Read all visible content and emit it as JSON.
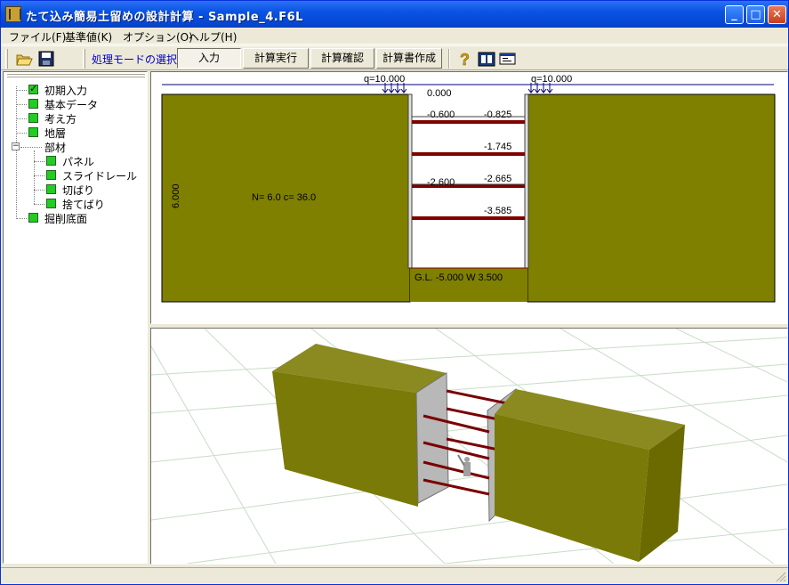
{
  "window": {
    "title": "たて込み簡易土留めの設計計算 - Sample_4.F6L"
  },
  "menu": {
    "items": [
      "ファイル(F)",
      "基準値(K)",
      "オプション(O)",
      "ヘルプ(H)"
    ]
  },
  "toolbar": {
    "mode_label": "処理モードの選択",
    "buttons": [
      "入力",
      "計算実行",
      "計算確認",
      "計算書作成"
    ]
  },
  "tree": {
    "items": [
      {
        "label": "初期入力",
        "checked": true
      },
      {
        "label": "基本データ"
      },
      {
        "label": "考え方"
      },
      {
        "label": "地層"
      },
      {
        "label": "部材"
      },
      {
        "label": "パネル"
      },
      {
        "label": "スライドレール"
      },
      {
        "label": "切ばり"
      },
      {
        "label": "捨てばり"
      },
      {
        "label": "掘削底面"
      }
    ]
  },
  "section": {
    "load_left": "q=10.000",
    "load_right": "q=10.000",
    "top_level": "0.000",
    "strut_left_1": "-0.600",
    "strut_right_1": "-0.825",
    "strut_right_2": "-1.745",
    "strut_left_2": "-2.600",
    "strut_right_3": "-2.665",
    "strut_right_4": "-3.585",
    "soil_params": "N= 6.0 c=  36.0",
    "layer_depth": "6.000",
    "bottom_label": "G.L. -5.000 W 3.500",
    "soil_color": "#7f7f00"
  }
}
